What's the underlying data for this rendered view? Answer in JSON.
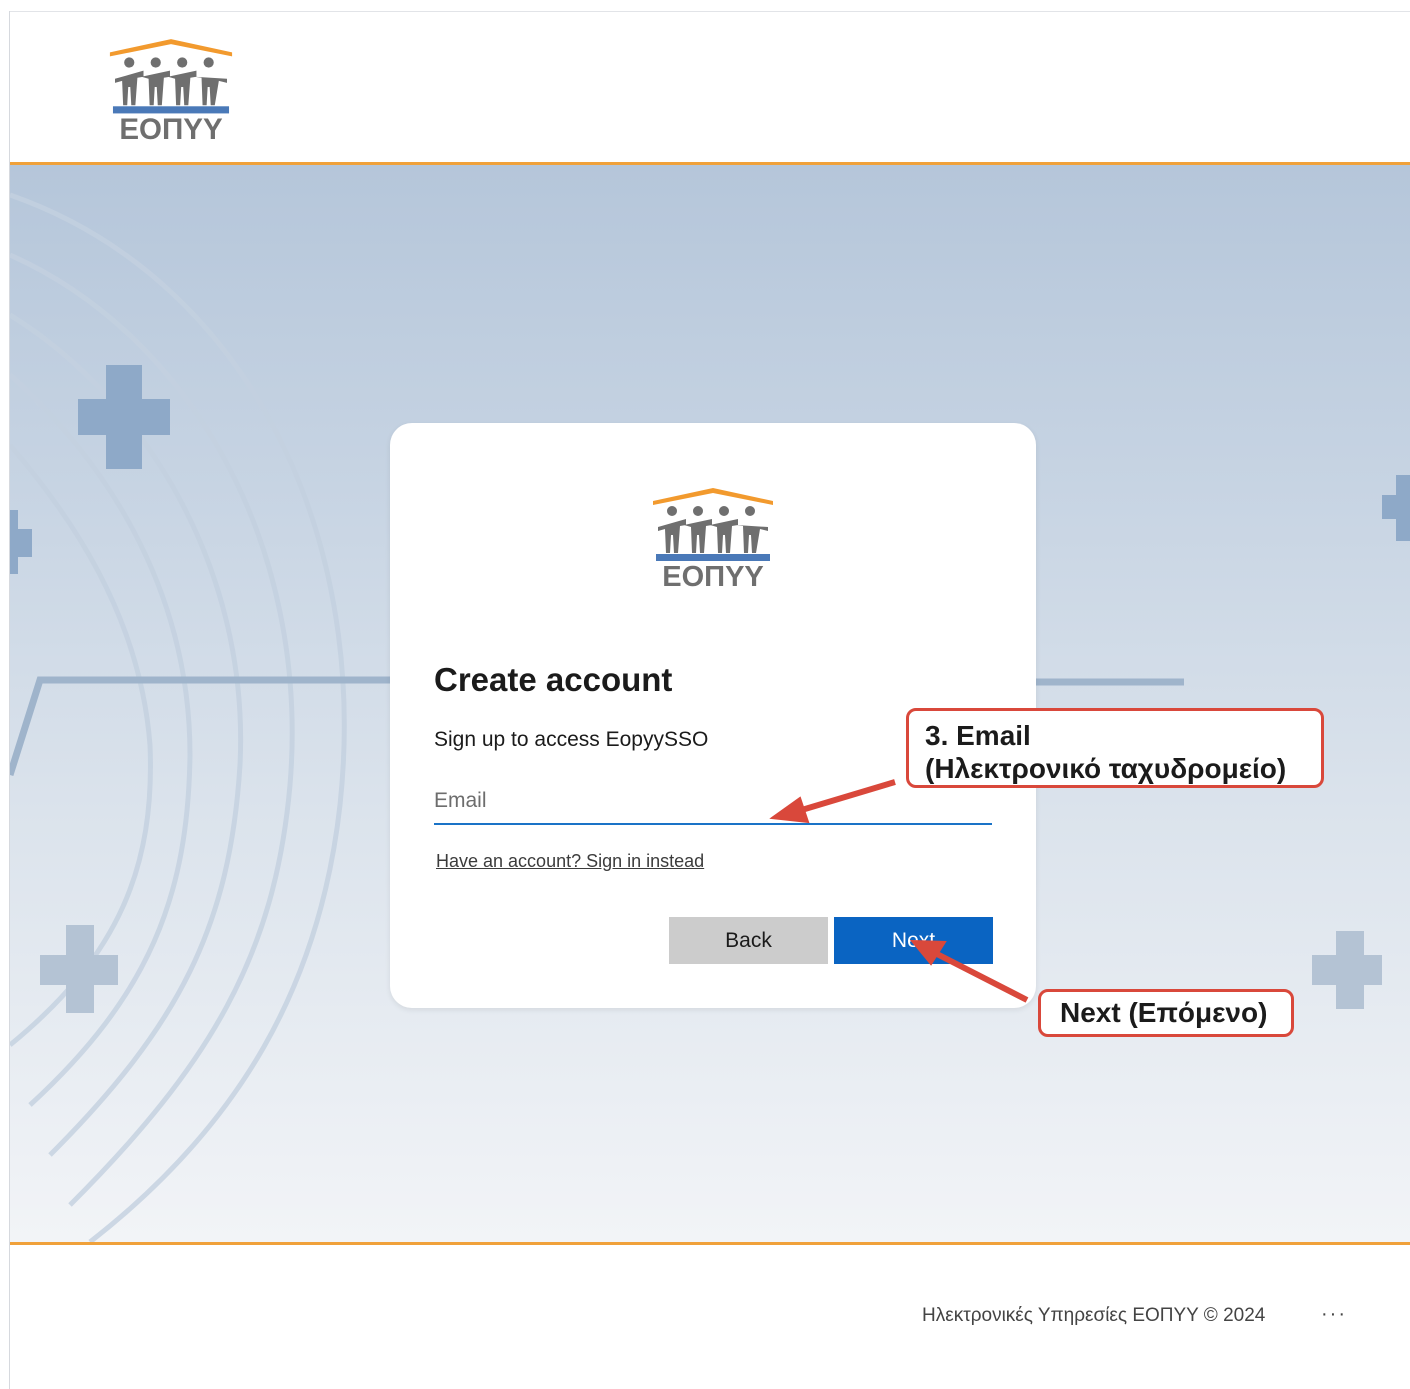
{
  "brand": {
    "logo_text": "ΕΟΠΥΥ",
    "accent": "#f0a13a",
    "primary": "#0a64c2"
  },
  "card": {
    "title": "Create account",
    "subtitle": "Sign up to access EopyySSO",
    "email_placeholder": "Email",
    "email_value": "",
    "signin_link": "Have an account? Sign in instead",
    "back_label": "Back",
    "next_label": "Next"
  },
  "annotations": {
    "email_line1": "3. Email",
    "email_line2": "(Ηλεκτρονικό ταχυδρομείο)",
    "next": "Next (Επόμενο)",
    "color": "#d9483b"
  },
  "footer": {
    "text": "Ηλεκτρονικές Υπηρεσίες ΕΟΠΥΥ  © 2024",
    "more": "···"
  }
}
